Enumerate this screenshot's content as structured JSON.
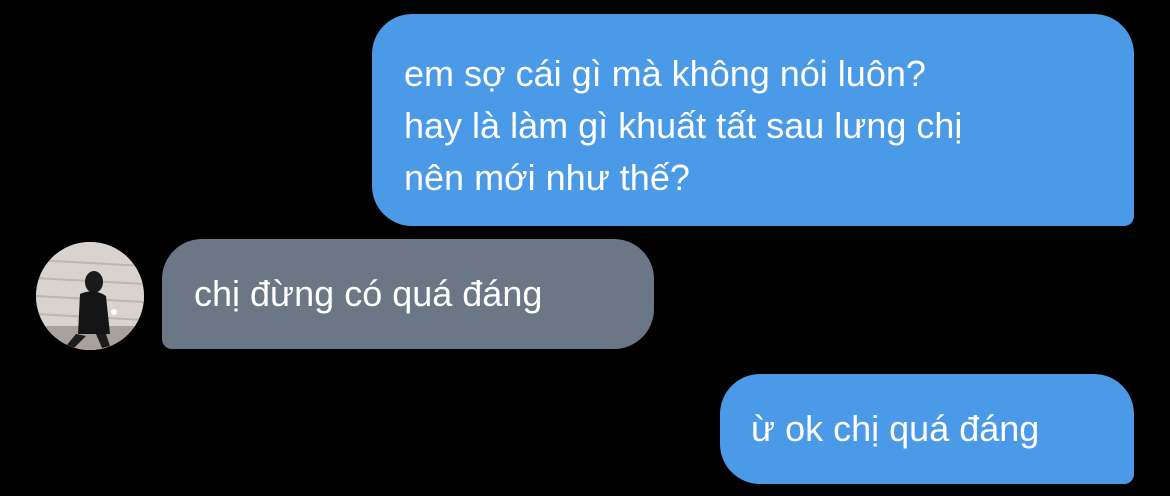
{
  "conversation": {
    "messages": [
      {
        "direction": "sent",
        "lines": [
          "em sợ cái gì mà không nói luôn?",
          "hay là làm gì khuất tất sau lưng chị",
          "nên mới như thế?"
        ]
      },
      {
        "direction": "received",
        "text": "chị đừng có quá đáng"
      },
      {
        "direction": "sent",
        "text": "ừ ok chị quá đáng"
      }
    ]
  },
  "colors": {
    "background": "#000000",
    "sent_bubble": "#4a9ae8",
    "received_bubble": "#6b7785",
    "text": "#ffffff"
  },
  "icons": {
    "avatar": "contact-avatar-photo"
  }
}
